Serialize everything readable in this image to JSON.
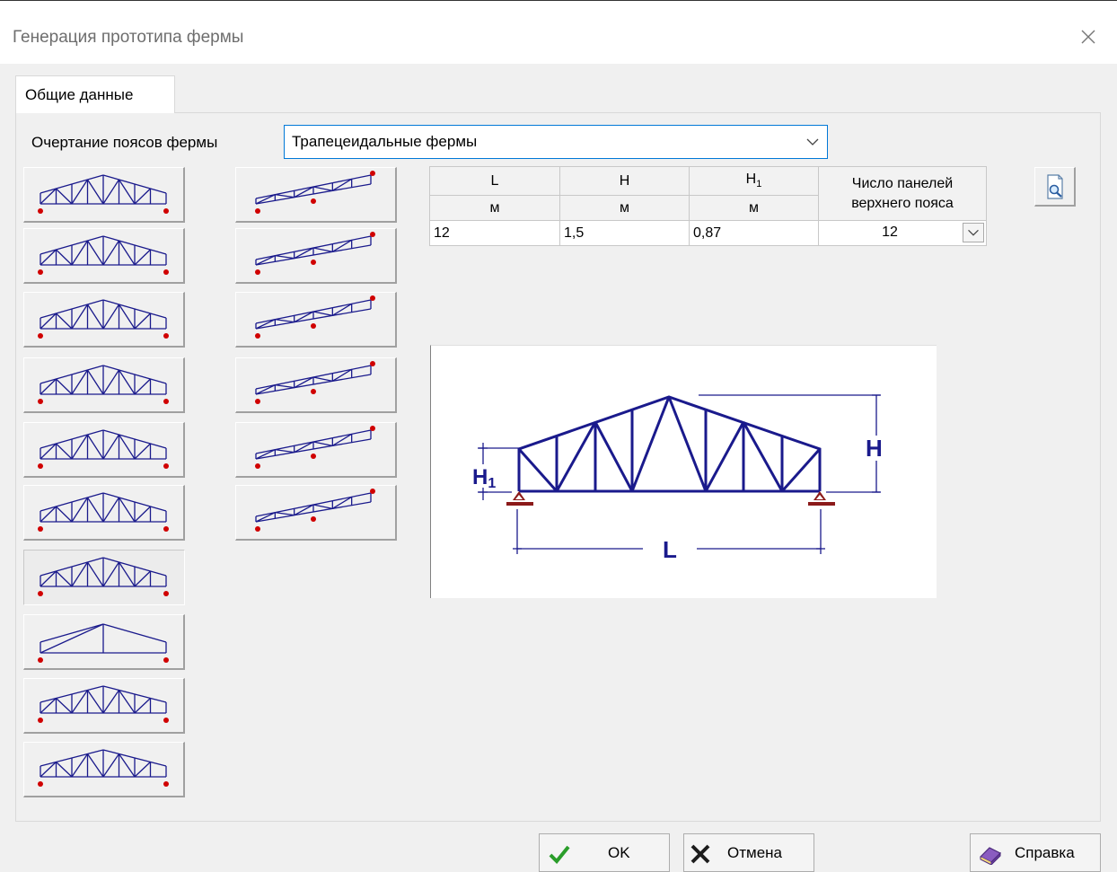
{
  "window": {
    "title": "Генерация прототипа фермы",
    "close_icon": "close-icon"
  },
  "tabs": [
    {
      "label": "Общие данные",
      "active": true
    }
  ],
  "belt_shape": {
    "label": "Очертание поясов фермы",
    "selected": "Трапецеидальные фермы"
  },
  "params_table": {
    "headers": [
      "L",
      "H",
      "H",
      "Число панелей верхнего пояса"
    ],
    "header_sub": "1",
    "units": [
      "м",
      "м",
      "м"
    ],
    "values": {
      "L": "12",
      "H": "1,5",
      "H1": "0,87",
      "panels": "12"
    }
  },
  "diagram": {
    "labels": {
      "H": "H",
      "H1": "H",
      "H1_sub": "1",
      "L": "L"
    }
  },
  "buttons": {
    "ok": "OK",
    "cancel": "Отмена",
    "help": "Справка"
  },
  "truss_types": {
    "left_column_count": 10,
    "right_column_count": 6,
    "selected_left_index": 6
  },
  "colors": {
    "truss": "#1a1a8c",
    "support": "#8b1a1a",
    "node": "#d00000",
    "accent": "#0078d7"
  }
}
